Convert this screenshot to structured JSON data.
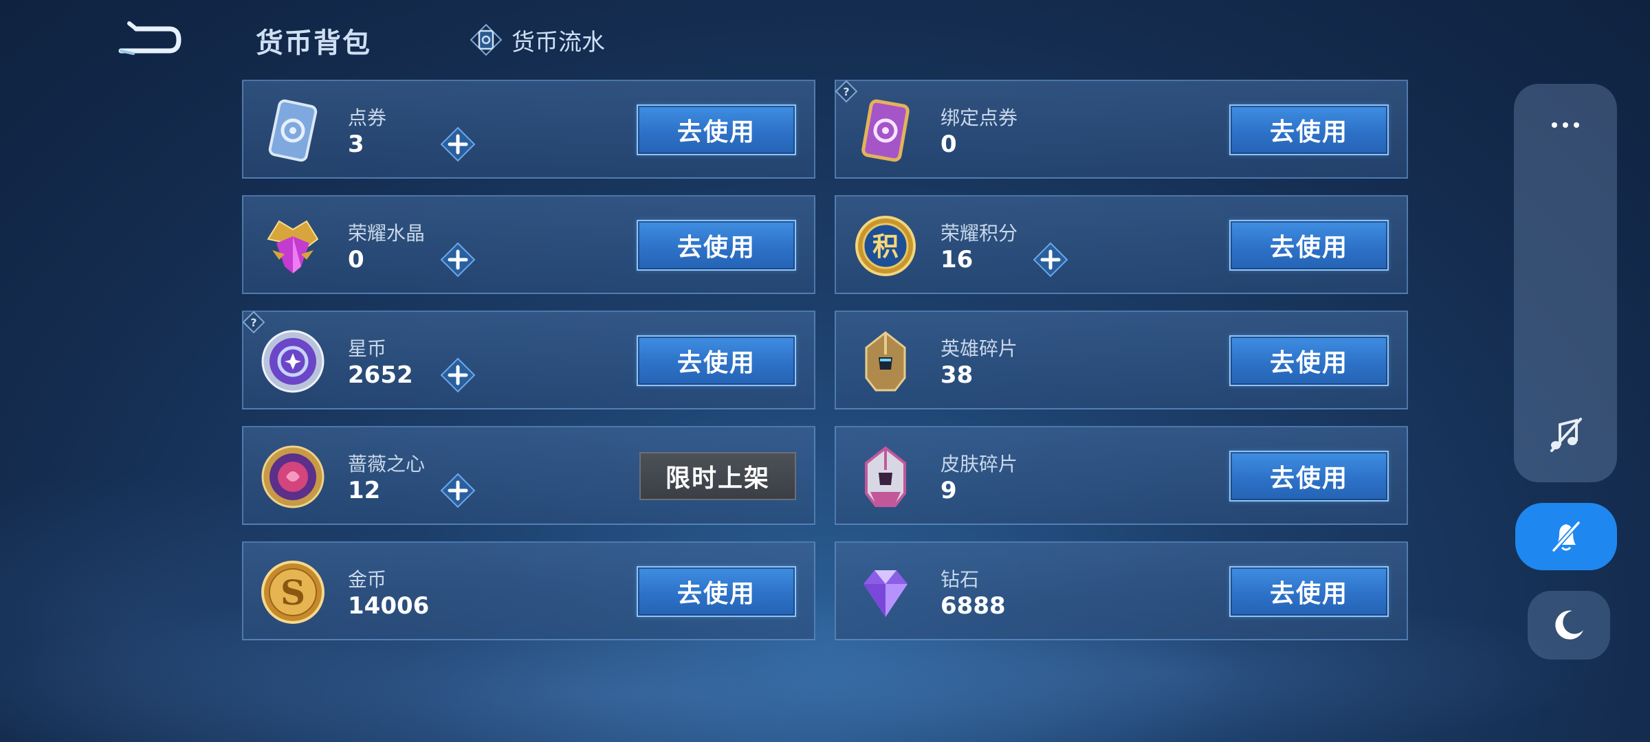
{
  "header": {
    "title": "货币背包",
    "flow_label": "货币流水"
  },
  "cards": [
    {
      "name": "点券",
      "value": "3",
      "icon": "voucher-card-icon",
      "plus": true,
      "help": false,
      "action": "去使用",
      "action_type": "use"
    },
    {
      "name": "绑定点券",
      "value": "0",
      "icon": "bound-voucher-card-icon",
      "plus": false,
      "help": true,
      "action": "去使用",
      "action_type": "use"
    },
    {
      "name": "荣耀水晶",
      "value": "0",
      "icon": "glory-crystal-icon",
      "plus": true,
      "help": false,
      "action": "去使用",
      "action_type": "use"
    },
    {
      "name": "荣耀积分",
      "value": "16",
      "icon": "glory-points-icon",
      "plus": true,
      "help": false,
      "action": "去使用",
      "action_type": "use"
    },
    {
      "name": "星币",
      "value": "2652",
      "icon": "star-coin-icon",
      "plus": true,
      "help": true,
      "action": "去使用",
      "action_type": "use"
    },
    {
      "name": "英雄碎片",
      "value": "38",
      "icon": "hero-fragment-icon",
      "plus": false,
      "help": false,
      "action": "去使用",
      "action_type": "use"
    },
    {
      "name": "蔷薇之心",
      "value": "12",
      "icon": "rose-heart-icon",
      "plus": true,
      "help": false,
      "action": "限时上架",
      "action_type": "limited"
    },
    {
      "name": "皮肤碎片",
      "value": "9",
      "icon": "skin-fragment-icon",
      "plus": false,
      "help": false,
      "action": "去使用",
      "action_type": "use"
    },
    {
      "name": "金币",
      "value": "14006",
      "icon": "gold-coin-icon",
      "plus": false,
      "help": false,
      "action": "去使用",
      "action_type": "use"
    },
    {
      "name": "钻石",
      "value": "6888",
      "icon": "diamond-icon",
      "plus": false,
      "help": false,
      "action": "去使用",
      "action_type": "use"
    }
  ],
  "side_panel": {
    "more_icon": "more-dots-icon",
    "music_icon": "music-off-icon",
    "mute_icon": "bell-off-icon",
    "night_icon": "moon-icon"
  },
  "colors": {
    "use_button": "#2d72c8",
    "limited_button": "#3b3f45",
    "mute_active": "#1e88f0"
  }
}
